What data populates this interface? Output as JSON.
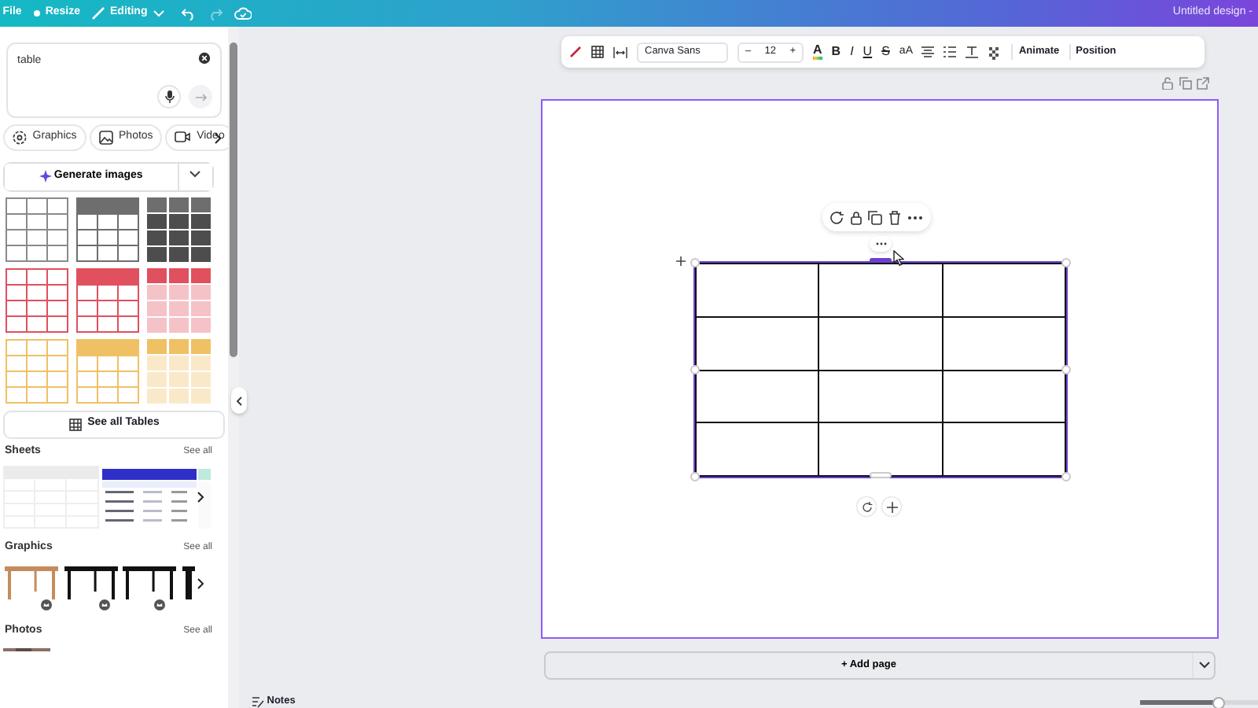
{
  "topbar": {
    "menu": [
      {
        "kind": "plain",
        "label": "File"
      },
      {
        "kind": "resize",
        "label": "Resize"
      },
      {
        "kind": "mode",
        "label": "Editing"
      }
    ],
    "title": "Untitled design -"
  },
  "search": {
    "value": "table"
  },
  "filters": [
    "Graphics",
    "Photos",
    "Video"
  ],
  "generate": {
    "label": "Generate images"
  },
  "table_styles": [
    {
      "kind": "grid",
      "color": "#8a8a8a"
    },
    {
      "kind": "header",
      "color": "#6e6e6e"
    },
    {
      "kind": "solid",
      "color": "#6e6e6e"
    },
    {
      "kind": "grid",
      "color": "#e0505f"
    },
    {
      "kind": "header",
      "color": "#e0505f"
    },
    {
      "kind": "filled",
      "color": "#e0505f"
    },
    {
      "kind": "grid",
      "color": "#f0c064"
    },
    {
      "kind": "header",
      "color": "#f0c064"
    },
    {
      "kind": "filled",
      "color": "#f0c064"
    }
  ],
  "see_all_tables": "See all Tables",
  "sections": [
    {
      "kind": "sheets",
      "title": "Sheets",
      "link": "See all"
    },
    {
      "kind": "graphics",
      "title": "Graphics",
      "link": "See all"
    },
    {
      "kind": "photos",
      "title": "Photos",
      "link": "See all"
    }
  ],
  "toolbar": {
    "font": "Canva Sans",
    "size": "12",
    "minus": "–",
    "plus": "+",
    "format": [
      {
        "kind": "color",
        "label": "A"
      },
      {
        "kind": "bold",
        "label": "B"
      },
      {
        "kind": "italic",
        "label": "I"
      },
      {
        "kind": "underline",
        "label": "U"
      },
      {
        "kind": "strike",
        "label": "S"
      },
      {
        "kind": "case",
        "label": "aA"
      }
    ],
    "actions": [
      "Animate",
      "Position"
    ]
  },
  "canvas": {
    "table_selected": true
  },
  "add_page": "+ Add page",
  "notes": "Notes",
  "zoom": {
    "level": 0.66
  }
}
